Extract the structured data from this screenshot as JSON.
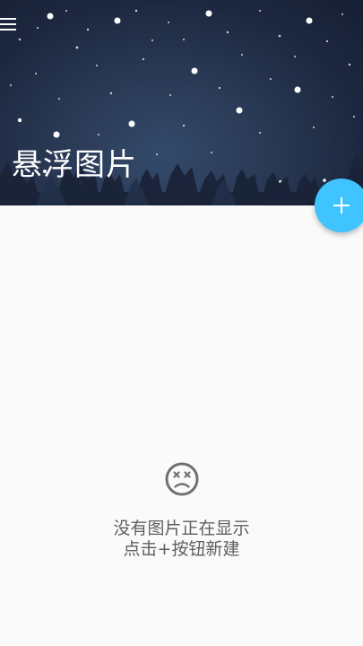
{
  "header": {
    "title": "悬浮图片",
    "menu_icon": "menu-icon"
  },
  "fab": {
    "icon": "plus-icon",
    "color": "#40c4ff"
  },
  "empty_state": {
    "icon": "sad-face-icon",
    "line1": "没有图片正在显示",
    "line2": "点击+按钮新建"
  }
}
